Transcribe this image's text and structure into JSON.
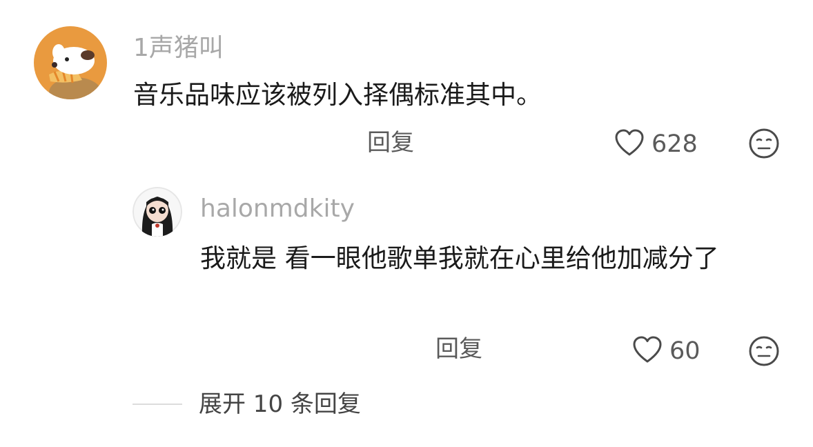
{
  "comment": {
    "username": "1声猪叫",
    "text": "音乐品味应该被列入择偶标准其中。",
    "reply_label": "回复",
    "like_count": "628",
    "like_icon": "heart-outline-icon",
    "dislike_icon": "meh-face-icon"
  },
  "reply": {
    "username": "halonmdkity",
    "text": "我就是 看一眼他歌单我就在心里给他加减分了",
    "reply_label": "回复",
    "like_count": "60",
    "like_icon": "heart-outline-icon",
    "dislike_icon": "meh-face-icon"
  },
  "expand": {
    "label": "展开 10 条回复"
  },
  "colors": {
    "username": "#a8a8a8",
    "text": "#1a1a1a",
    "action": "#5a5a5a",
    "avatar_bg": "#e99a3f"
  }
}
